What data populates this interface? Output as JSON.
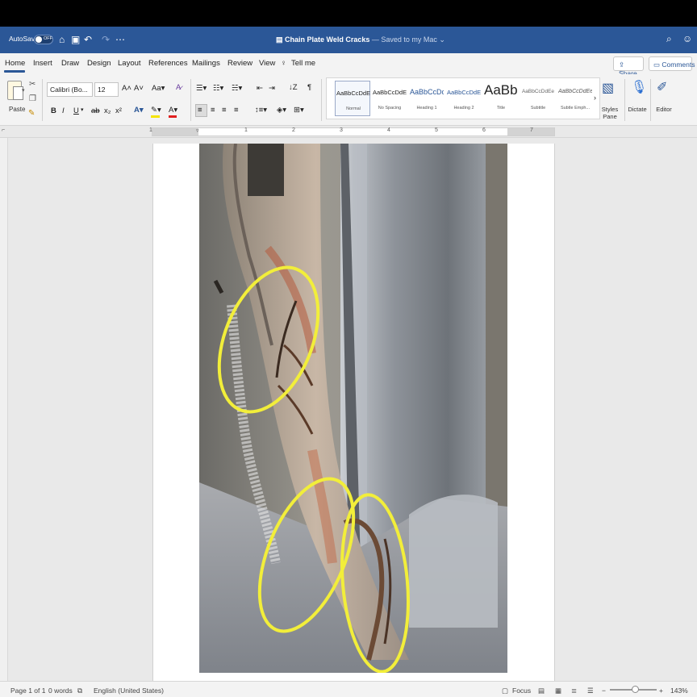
{
  "titlebar": {
    "autosave_label": "AutoSave",
    "autosave_state": "OFF",
    "doc_title": "Chain Plate Weld Cracks",
    "saved_status": " — Saved to my Mac",
    "accent": "#2b5797"
  },
  "tabs": [
    "Home",
    "Insert",
    "Draw",
    "Design",
    "Layout",
    "References",
    "Mailings",
    "Review",
    "View"
  ],
  "tell_me": "Tell me",
  "share_label": "Share",
  "comments_label": "Comments",
  "ribbon": {
    "paste_label": "Paste",
    "font_name": "Calibri (Bo...",
    "font_size": "12",
    "styles": [
      {
        "sample": "AaBbCcDdEe",
        "name": "Normal"
      },
      {
        "sample": "AaBbCcDdEe",
        "name": "No Spacing"
      },
      {
        "sample": "AaBbCcDc",
        "name": "Heading 1"
      },
      {
        "sample": "AaBbCcDdEe",
        "name": "Heading 2"
      },
      {
        "sample": "AaBb(",
        "name": "Title"
      },
      {
        "sample": "AaBbCcDdEe",
        "name": "Subtitle"
      },
      {
        "sample": "AaBbCcDdEe",
        "name": "Subtle Emph..."
      }
    ],
    "styles_pane_label": "Styles Pane",
    "dictate_label": "Dictate",
    "editor_label": "Editor"
  },
  "ruler_numbers": [
    "1",
    "1",
    "2",
    "3",
    "4",
    "5",
    "6",
    "7"
  ],
  "statusbar": {
    "page": "Page 1 of 1",
    "words": "0 words",
    "language": "English (United States)",
    "focus": "Focus",
    "zoom": "143%"
  }
}
